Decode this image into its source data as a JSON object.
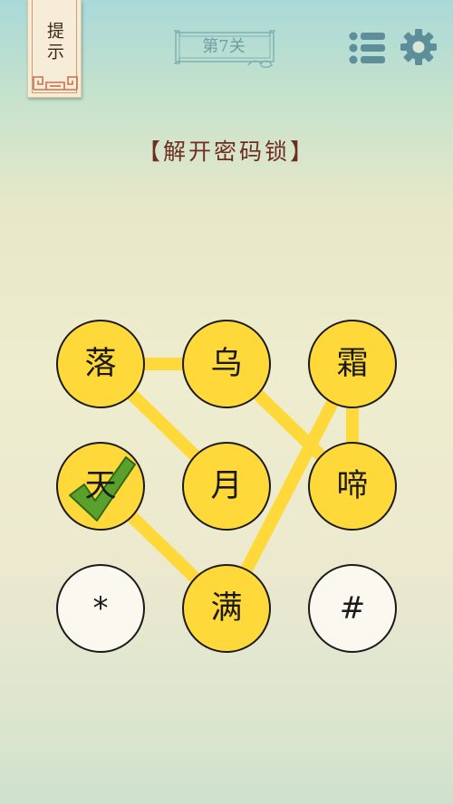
{
  "hint": {
    "label": "提示"
  },
  "level": {
    "label": "第7关"
  },
  "puzzle": {
    "title": "【解开密码锁】"
  },
  "theme": {
    "node_active": "#ffd93a",
    "node_inactive": "#fbf8f0",
    "line": "#ffd93a",
    "border": "#1a1a1a",
    "check": "#5aa02c",
    "icon": "#5e8e99"
  },
  "nodes": [
    {
      "id": "n1",
      "char": "落",
      "active": true
    },
    {
      "id": "n2",
      "char": "乌",
      "active": true
    },
    {
      "id": "n3",
      "char": "霜",
      "active": true
    },
    {
      "id": "n4",
      "char": "天",
      "active": true,
      "checked": true
    },
    {
      "id": "n5",
      "char": "月",
      "active": true
    },
    {
      "id": "n6",
      "char": "啼",
      "active": true
    },
    {
      "id": "n7",
      "char": "*",
      "active": false
    },
    {
      "id": "n8",
      "char": "满",
      "active": true
    },
    {
      "id": "n9",
      "char": "#",
      "active": false
    }
  ],
  "connections": [
    [
      "落",
      "乌"
    ],
    [
      "落",
      "月"
    ],
    [
      "乌",
      "啼"
    ],
    [
      "霜",
      "啼"
    ],
    [
      "霜",
      "满"
    ],
    [
      "天",
      "满"
    ]
  ]
}
